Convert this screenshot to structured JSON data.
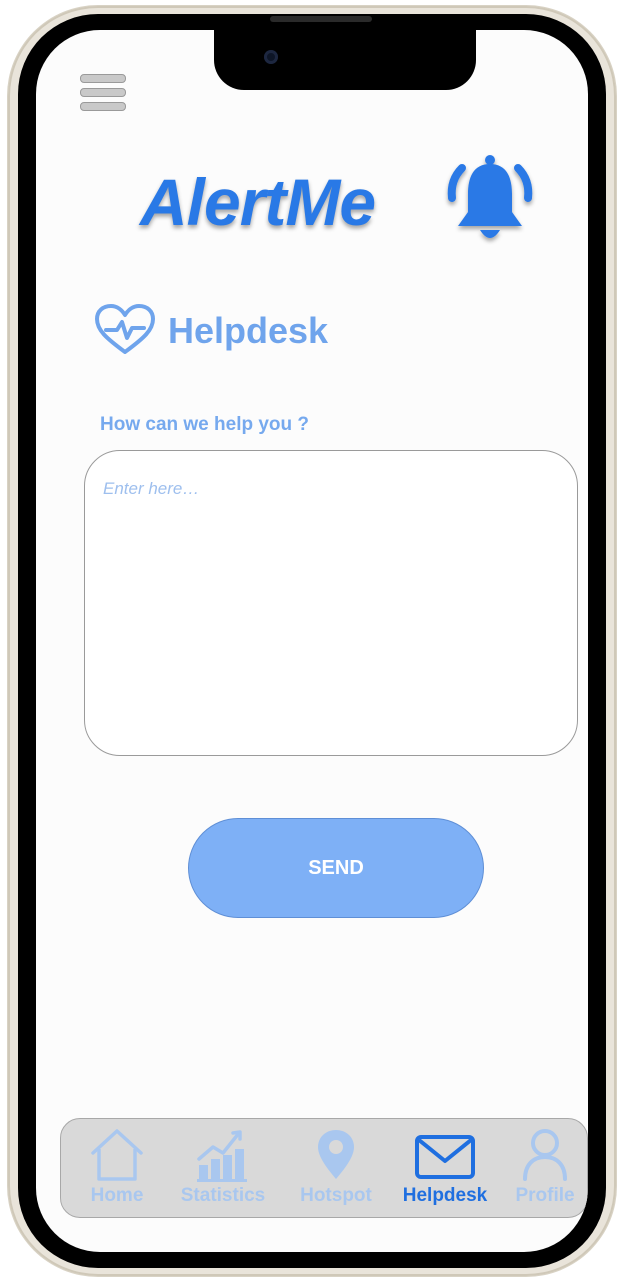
{
  "app": {
    "name": "AlertMe"
  },
  "header": {
    "menu_icon": "hamburger-menu-icon",
    "logo_icon": "bell-ringing-icon"
  },
  "page": {
    "title": "Helpdesk",
    "title_icon": "heart-pulse-icon"
  },
  "form": {
    "label": "How can we help you ?",
    "placeholder": "Enter here…",
    "value": "",
    "submit_label": "SEND"
  },
  "tabbar": {
    "items": [
      {
        "label": "Home",
        "icon": "home-icon",
        "active": false
      },
      {
        "label": "Statistics",
        "icon": "statistics-icon",
        "active": false
      },
      {
        "label": "Hotspot",
        "icon": "map-pin-icon",
        "active": false
      },
      {
        "label": "Helpdesk",
        "icon": "envelope-icon",
        "active": true
      },
      {
        "label": "Profile",
        "icon": "user-icon",
        "active": false
      }
    ]
  },
  "colors": {
    "brand": "#2979e6",
    "accent_light": "#6fa4ec",
    "button": "#7eb0f6",
    "tab_active": "#1f6fe0",
    "tab_inactive": "#a9c7ef"
  }
}
